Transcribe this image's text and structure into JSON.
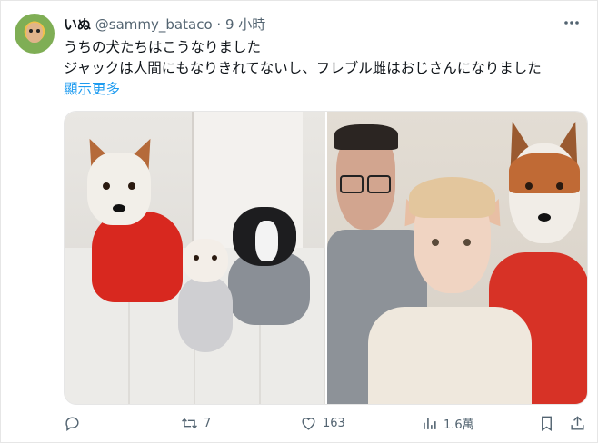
{
  "user": {
    "display_name": "いぬ",
    "handle": "@sammy_bataco",
    "separator": "·",
    "time": "9 小時"
  },
  "tweet": {
    "line1": "うちの犬たちはこうなりました",
    "line2": "ジャックは人間にもなりきれてないし、フレブル雌はおじさんになりました",
    "show_more": "顯示更多"
  },
  "actions": {
    "reply_count": "",
    "retweet_count": "7",
    "like_count": "163",
    "views_count": "1.6萬"
  },
  "icons": [
    "more-icon",
    "reply-icon",
    "retweet-icon",
    "like-icon",
    "views-icon",
    "bookmark-icon",
    "share-icon"
  ],
  "colors": {
    "link": "#1d9bf0",
    "muted": "#536471",
    "text": "#0f1419"
  }
}
